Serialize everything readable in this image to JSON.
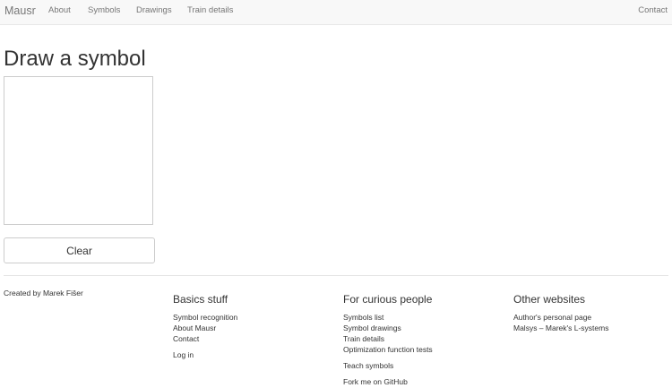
{
  "navbar": {
    "brand": "Mausr",
    "items": [
      "About",
      "Symbols",
      "Drawings",
      "Train details"
    ],
    "contact": "Contact"
  },
  "main": {
    "title": "Draw a symbol",
    "clear_label": "Clear"
  },
  "footer": {
    "credit": "Created by Marek Fišer",
    "columns": [
      {
        "heading": "Basics stuff",
        "links": [
          "Symbol recognition",
          "About Mausr",
          "Contact",
          "Log in"
        ]
      },
      {
        "heading": "For curious people",
        "links": [
          "Symbols list",
          "Symbol drawings",
          "Train details",
          "Optimization function tests",
          "Teach symbols",
          "Fork me on GitHub"
        ]
      },
      {
        "heading": "Other websites",
        "links": [
          "Author's personal page",
          "Malsys – Marek's L-systems"
        ]
      }
    ]
  }
}
